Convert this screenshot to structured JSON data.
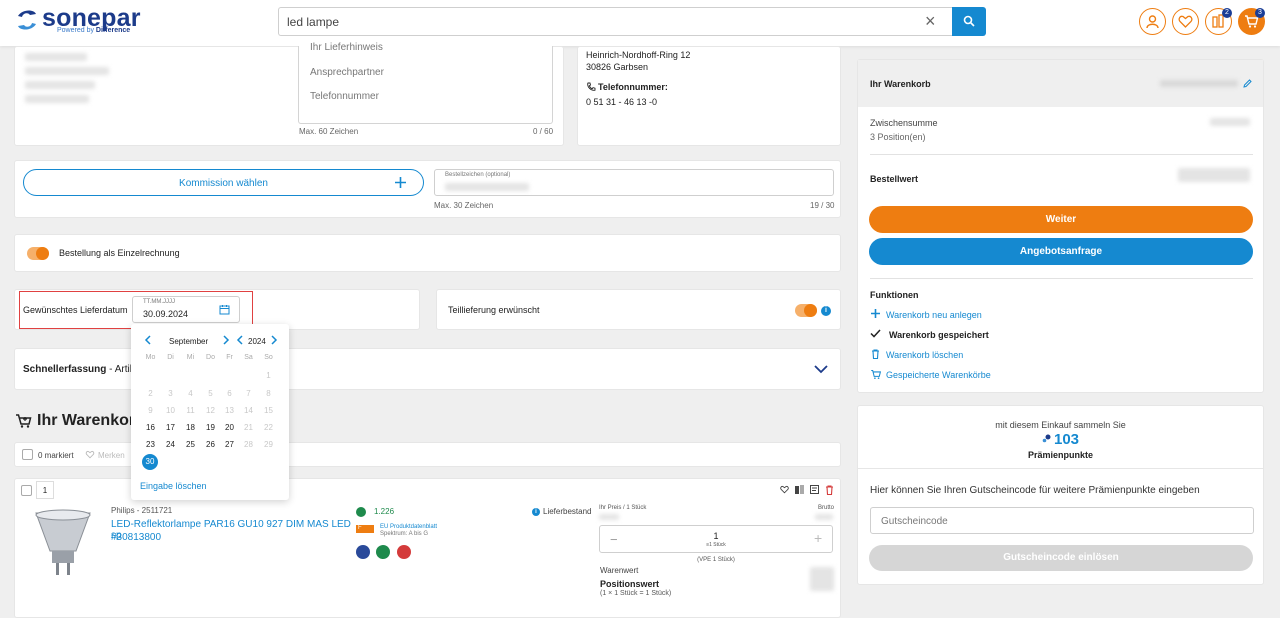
{
  "header": {
    "logo_text": "sonepar",
    "logo_sub_powered": "Powered by",
    "logo_sub_brand": "Difference",
    "search_value": "led lampe",
    "badges": {
      "compare": "2",
      "cart": "3"
    }
  },
  "address_fields": {
    "hint": "Ihr Lieferhinweis",
    "contact": "Ansprechpartner",
    "phone": "Telefonnummer",
    "max": "Max. 60 Zeichen",
    "count": "0 / 60"
  },
  "seller": {
    "street": "Heinrich-Nordhoff-Ring 12",
    "city": "30826 Garbsen",
    "phone_label": "Telefonnummer:",
    "phone_value": "0 51 31 - 46 13 -0"
  },
  "commission": {
    "button_label": "Kommission wählen",
    "order_ref_label": "Bestellzeichen (optional)",
    "order_ref_max": "Max. 30 Zeichen",
    "order_ref_count": "19 / 30"
  },
  "single_invoice": {
    "label": "Bestellung als Einzelrechnung"
  },
  "delivery": {
    "label": "Gewünschtes Lieferdatum",
    "placeholder": "TT.MM.JJJJ",
    "value": "30.09.2024",
    "partial_label": "Teillieferung erwünscht"
  },
  "calendar": {
    "month": "September",
    "year": "2024",
    "weekdays": [
      "Mo",
      "Di",
      "Mi",
      "Do",
      "Fr",
      "Sa",
      "So"
    ],
    "weeks": [
      [
        "",
        "",
        "",
        "",
        "",
        "",
        "1"
      ],
      [
        "2",
        "3",
        "4",
        "5",
        "6",
        "7",
        "8"
      ],
      [
        "9",
        "10",
        "11",
        "12",
        "13",
        "14",
        "15"
      ],
      [
        "16",
        "17",
        "18",
        "19",
        "20",
        "21",
        "22"
      ],
      [
        "23",
        "24",
        "25",
        "26",
        "27",
        "28",
        "29"
      ],
      [
        "30",
        "",
        "",
        "",
        "",
        "",
        ""
      ]
    ],
    "clear_label": "Eingabe löschen"
  },
  "quick_entry": {
    "label_bold": "Schnellerfassung",
    "label_rest": " - Artikel p"
  },
  "cart_section": {
    "title": "Ihr Warenkorb",
    "marked": "0 markiert",
    "remember": "Merken"
  },
  "item": {
    "position": "1",
    "brand": "Philips - 2511721",
    "name": "LED-Reflektorlampe PAR16 GU10 927 DIM MAS LED sp",
    "number": "#30813800",
    "stock": "1.226",
    "eu_label": "EU Produktdatenblatt",
    "spectrum": "Spektrum: A bis G",
    "energy_letter": "F",
    "lieferbestand": "Lieferbestand",
    "your_price": "Ihr Preis / 1 Stück",
    "brutto": "Brutto",
    "qty": "1",
    "qty_unit": "≡1 Stück",
    "vpe": "(VPE 1 Stück)",
    "warenwert": "Warenwert",
    "positionswert": "Positionswert",
    "calc": "(1 × 1 Stück = 1 Stück)"
  },
  "summary": {
    "title": "Ihr Warenkorb",
    "subtotal": "Zwischensumme",
    "positions": "3 Position(en)",
    "order_value": "Bestellwert",
    "continue": "Weiter",
    "quote": "Angebotsanfrage",
    "functions_title": "Funktionen",
    "new_cart": "Warenkorb neu anlegen",
    "saved": "Warenkorb gespeichert",
    "delete": "Warenkorb löschen",
    "saved_carts": "Gespeicherte Warenkörbe"
  },
  "points": {
    "intro": "mit diesem Einkauf sammeln Sie",
    "value": "103",
    "label": "Prämienpunkte",
    "voucher_text": "Hier können Sie Ihren Gutscheincode für weitere Prämienpunkte eingeben",
    "voucher_placeholder": "Gutscheincode",
    "redeem": "Gutscheincode einlösen"
  },
  "colors": {
    "accent": "#ee7d11",
    "primary": "#1589d0",
    "brand": "#1c3b8a"
  }
}
